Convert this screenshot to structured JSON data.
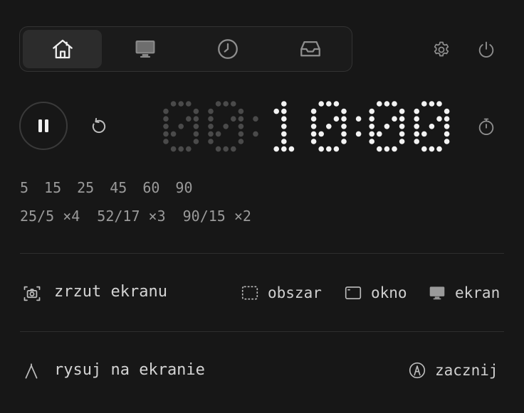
{
  "tabs": [
    {
      "name": "home-icon",
      "active": true
    },
    {
      "name": "monitor-icon",
      "active": false
    },
    {
      "name": "clock-icon",
      "active": false
    },
    {
      "name": "inbox-icon",
      "active": false
    }
  ],
  "timer": {
    "display": "00:10:00",
    "hours": "00",
    "minutes": "10",
    "seconds": "00"
  },
  "presets": [
    "5",
    "15",
    "25",
    "45",
    "60",
    "90"
  ],
  "cycles": [
    "25/5 ×4",
    "52/17 ×3",
    "90/15 ×2"
  ],
  "screenshot": {
    "label": "zrzut ekranu",
    "options": [
      {
        "icon": "dashed-region-icon",
        "label": "obszar"
      },
      {
        "icon": "window-icon",
        "label": "okno"
      },
      {
        "icon": "monitor-icon",
        "label": "ekran"
      }
    ]
  },
  "draw": {
    "label": "rysuj na ekranie",
    "action": "zacznij"
  },
  "colors": {
    "background": "#171717",
    "lit": "#f2f2f2",
    "dim": "#4a4a4a"
  }
}
